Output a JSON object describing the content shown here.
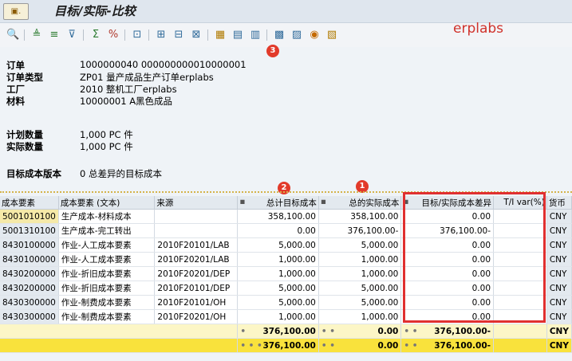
{
  "window": {
    "title": "目标/实际-比较",
    "menu_icon": "sap-menu-icon"
  },
  "brand": "erplabs",
  "markers": [
    "1",
    "2",
    "3"
  ],
  "header": {
    "order_label": "订单",
    "order_value": "1000000040 000000000010000001",
    "order_type_label": "订单类型",
    "order_type_value": "ZP01 量产成品生产订单erplabs",
    "plant_label": "工厂",
    "plant_value": "2010 整机工厂erplabs",
    "material_label": "材料",
    "material_value": "10000001 A黑色成品",
    "planned_qty_label": "计划数量",
    "planned_qty_value": "1,000 PC 件",
    "actual_qty_label": "实际数量",
    "actual_qty_value": "1,000 PC 件",
    "target_version_label": "目标成本版本",
    "target_version_value": "0 总差异的目标成本"
  },
  "columns": {
    "cost_element": "成本要素",
    "cost_element_text": "成本要素 (文本)",
    "origin": "来源",
    "total_target": "总计目标成本",
    "total_actual": "总的实际成本",
    "variance": "目标/实际成本差异",
    "ti_var": "T/I var(%)",
    "currency": "货币"
  },
  "rows": [
    {
      "ce": "5001010100",
      "text": "生产成本-材料成本",
      "origin": "",
      "target": "358,100.00",
      "actual": "358,100.00",
      "variance": "0.00",
      "ti": "",
      "cur": "CNY"
    },
    {
      "ce": "5001310100",
      "text": "生产成本-完工转出",
      "origin": "",
      "target": "0.00",
      "actual": "376,100.00-",
      "variance": "376,100.00-",
      "ti": "",
      "cur": "CNY"
    },
    {
      "ce": "8430100000",
      "text": "作业-人工成本要素",
      "origin": "2010F20101/LAB",
      "target": "5,000.00",
      "actual": "5,000.00",
      "variance": "0.00",
      "ti": "",
      "cur": "CNY"
    },
    {
      "ce": "8430100000",
      "text": "作业-人工成本要素",
      "origin": "2010F20201/LAB",
      "target": "1,000.00",
      "actual": "1,000.00",
      "variance": "0.00",
      "ti": "",
      "cur": "CNY"
    },
    {
      "ce": "8430200000",
      "text": "作业-折旧成本要素",
      "origin": "2010F20201/DEP",
      "target": "1,000.00",
      "actual": "1,000.00",
      "variance": "0.00",
      "ti": "",
      "cur": "CNY"
    },
    {
      "ce": "8430200000",
      "text": "作业-折旧成本要素",
      "origin": "2010F20101/DEP",
      "target": "5,000.00",
      "actual": "5,000.00",
      "variance": "0.00",
      "ti": "",
      "cur": "CNY"
    },
    {
      "ce": "8430300000",
      "text": "作业-制费成本要素",
      "origin": "2010F20101/OH",
      "target": "5,000.00",
      "actual": "5,000.00",
      "variance": "0.00",
      "ti": "",
      "cur": "CNY"
    },
    {
      "ce": "8430300000",
      "text": "作业-制费成本要素",
      "origin": "2010F20201/OH",
      "target": "1,000.00",
      "actual": "1,000.00",
      "variance": "0.00",
      "ti": "",
      "cur": "CNY"
    }
  ],
  "subtotal": {
    "target": "376,100.00",
    "actual": "0.00",
    "variance": "376,100.00-",
    "cur": "CNY",
    "agg": "•",
    "agg2": "• •"
  },
  "grand_total": {
    "target": "376,100.00",
    "actual": "0.00",
    "variance": "376,100.00-",
    "cur": "CNY",
    "agg": "• • •",
    "agg2": "• •"
  },
  "colors": {
    "accent_red": "#e03030",
    "total_yellow": "#f9e23c",
    "subtotal_yellow": "#fcf6c6"
  }
}
